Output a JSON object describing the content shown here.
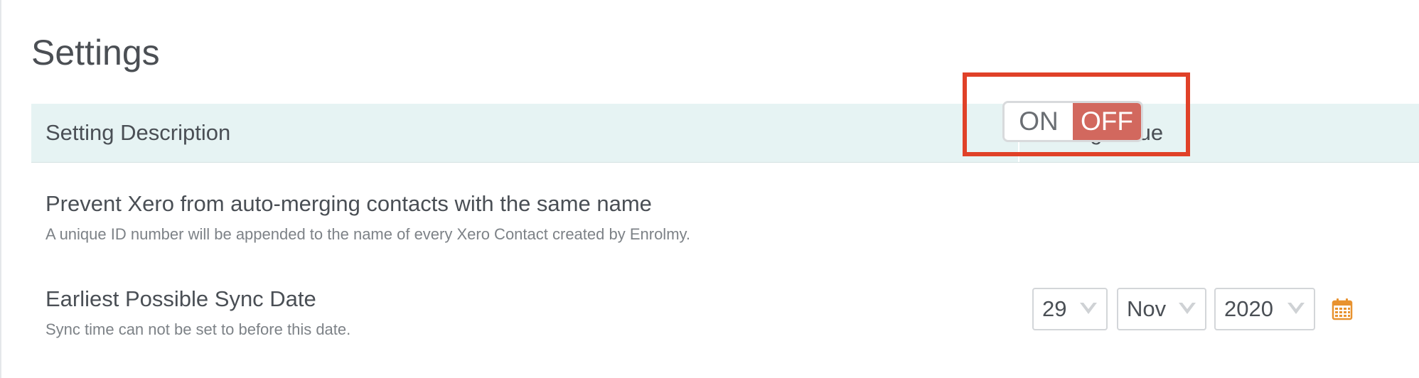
{
  "page": {
    "title": "Settings"
  },
  "table": {
    "headers": {
      "description": "Setting Description",
      "value": "Setting Value"
    },
    "rows": [
      {
        "title": "Prevent Xero from auto-merging contacts with the same name",
        "subtitle": "A unique ID number will be appended to the name of every Xero Contact created by Enrolmy.",
        "control": {
          "type": "toggle",
          "on_label": "ON",
          "off_label": "OFF",
          "state": "OFF"
        }
      },
      {
        "title": "Earliest Possible Sync Date",
        "subtitle": "Sync time can not be set to before this date.",
        "control": {
          "type": "date",
          "day": "29",
          "month": "Nov",
          "year": "2020",
          "calendar_icon": "calendar-icon"
        }
      }
    ]
  },
  "colors": {
    "header_bg": "#e6f3f3",
    "toggle_off_bg": "#d2685e",
    "highlight_border": "#e04128",
    "calendar_icon": "#e8922f"
  }
}
